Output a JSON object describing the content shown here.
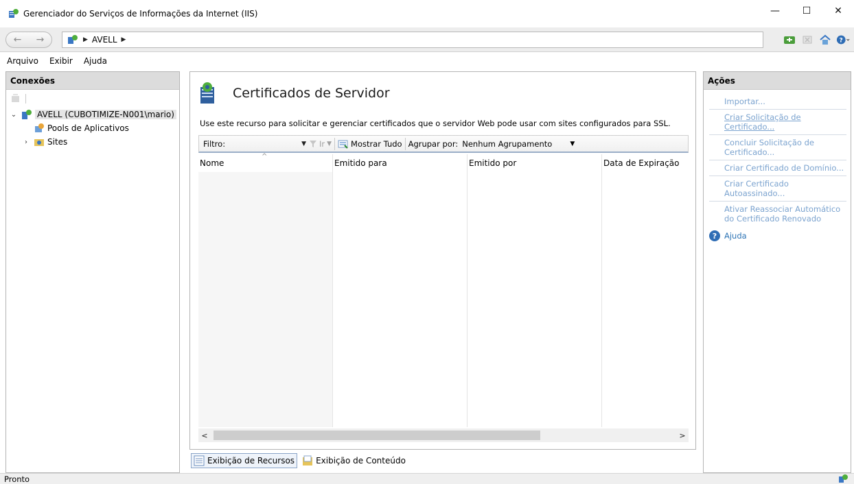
{
  "window": {
    "title": "Gerenciador do Serviços de Informações da Internet (IIS)",
    "min_glyph": "—",
    "max_glyph": "☐",
    "close_glyph": "✕"
  },
  "address": {
    "back_glyph": "←",
    "forward_glyph": "→",
    "crumbs": [
      "AVELL"
    ],
    "tools": [
      "connect-icon",
      "stop-icon",
      "home-icon",
      "help-icon"
    ]
  },
  "menu": [
    {
      "label": "Arquivo"
    },
    {
      "label": "Exibir"
    },
    {
      "label": "Ajuda"
    }
  ],
  "connections": {
    "header": "Conexões",
    "tree": [
      {
        "label": "AVELL (CUBOTIMIZE-N001\\mario)",
        "expander": "⌄",
        "icon": "server-icon"
      },
      {
        "label": "Pools de Aplicativos",
        "expander": "",
        "icon": "app-pool-icon"
      },
      {
        "label": "Sites",
        "expander": "›",
        "icon": "sites-folder-icon"
      }
    ]
  },
  "main": {
    "title": "Certificados de Servidor",
    "description": "Use este recurso para solicitar e gerenciar certificados que o servidor Web pode usar com sites configurados para SSL.",
    "filter": {
      "label": "Filtro:",
      "go_label": "Ir",
      "show_all_label": "Mostrar Tudo",
      "group_by_label": "Agrupar por:",
      "group_by_value": "Nenhum Agrupamento"
    },
    "columns": [
      "Nome",
      "Emitido para",
      "Emitido por",
      "Data de Expiração"
    ],
    "rows": []
  },
  "view_tabs": [
    {
      "label": "Exibição de Recursos",
      "active": true
    },
    {
      "label": "Exibição de Conteúdo",
      "active": false
    }
  ],
  "actions": {
    "header": "Ações",
    "items": [
      {
        "label": "Importar..."
      },
      {
        "label": "Criar Solicitação de Certificado..."
      },
      {
        "label": "Concluir Solicitação de Certificado..."
      },
      {
        "label": "Criar Certificado de Domínio..."
      },
      {
        "label": "Criar Certificado Autoassinado..."
      },
      {
        "label": "Ativar Reassociar Automático do Certificado Renovado"
      }
    ],
    "help_label": "Ajuda"
  },
  "status": {
    "text": "Pronto"
  }
}
